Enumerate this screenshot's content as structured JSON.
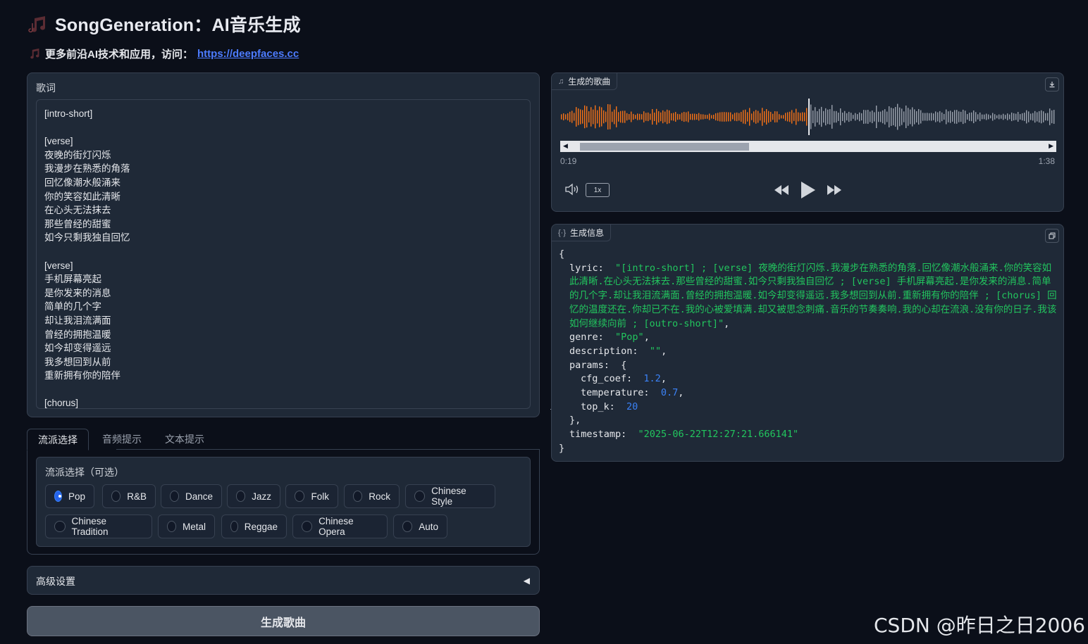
{
  "header": {
    "title": "SongGeneration：AI音乐生成",
    "subtitle_prefix": "更多前沿AI技术和应用，访问：",
    "subtitle_link": "https://deepfaces.cc"
  },
  "lyrics": {
    "label": "歌词",
    "text": "[intro-short]\n\n[verse]\n夜晚的街灯闪烁\n我漫步在熟悉的角落\n回忆像潮水般涌来\n你的笑容如此清晰\n在心头无法抹去\n那些曾经的甜蜜\n如今只剩我独自回忆\n\n[verse]\n手机屏幕亮起\n是你发来的消息\n简单的几个字\n却让我泪流满面\n曾经的拥抱温暖\n如今却变得遥远\n我多想回到从前\n重新拥有你的陪伴\n\n[chorus]"
  },
  "tabs": [
    {
      "label": "流派选择",
      "active": true
    },
    {
      "label": "音频提示",
      "active": false
    },
    {
      "label": "文本提示",
      "active": false
    }
  ],
  "genre": {
    "label": "流派选择（可选）",
    "selected": "Pop",
    "options": [
      "Pop",
      "R&B",
      "Dance",
      "Jazz",
      "Folk",
      "Rock",
      "Chinese Style",
      "Chinese Tradition",
      "Metal",
      "Reggae",
      "Chinese Opera",
      "Auto"
    ]
  },
  "advanced": {
    "label": "高级设置",
    "caret": "◀"
  },
  "generate_button": "生成歌曲",
  "audio": {
    "label": "生成的歌曲",
    "current_time": "0:19",
    "duration": "1:38",
    "progress": 0.19,
    "playback_rate": "1x",
    "icons": [
      "music-note-icon",
      "download-icon",
      "volume-icon",
      "rewind-icon",
      "play-icon",
      "fast-forward-icon"
    ],
    "played_color": "#f97316",
    "unplayed_color": "#9ca3af"
  },
  "info": {
    "label": "生成信息",
    "open_brace": "{",
    "close_brace": "}",
    "lyric_key": "lyric:",
    "lyric_value": "\"[intro-short] ; [verse] 夜晚的街灯闪烁.我漫步在熟悉的角落.回忆像潮水般涌来.你的笑容如此清晰.在心头无法抹去.那些曾经的甜蜜.如今只剩我独自回忆 ; [verse] 手机屏幕亮起.是你发来的消息.简单的几个字.却让我泪流满面.曾经的拥抱温暖.如今却变得遥远.我多想回到从前.重新拥有你的陪伴 ; [chorus] 回忆的温度还在.你却已不在.我的心被爱填满.却又被思念刺痛.音乐的节奏奏响.我的心却在流浪.没有你的日子.我该如何继续向前 ; [outro-short]\"",
    "genre_key": "genre:",
    "genre_value": "\"Pop\"",
    "description_key": "description:",
    "description_value": "\"\"",
    "params_key": "params:",
    "params_open": "{",
    "params_close": "},",
    "cfg_key": "cfg_coef:",
    "cfg_value": "1.2",
    "temp_key": "temperature:",
    "temp_value": "0.7",
    "topk_key": "top_k:",
    "topk_value": "20",
    "timestamp_key": "timestamp:",
    "timestamp_value": "\"2025-06-22T12:27:21.666141\""
  },
  "watermark": "CSDN @昨日之日2006"
}
